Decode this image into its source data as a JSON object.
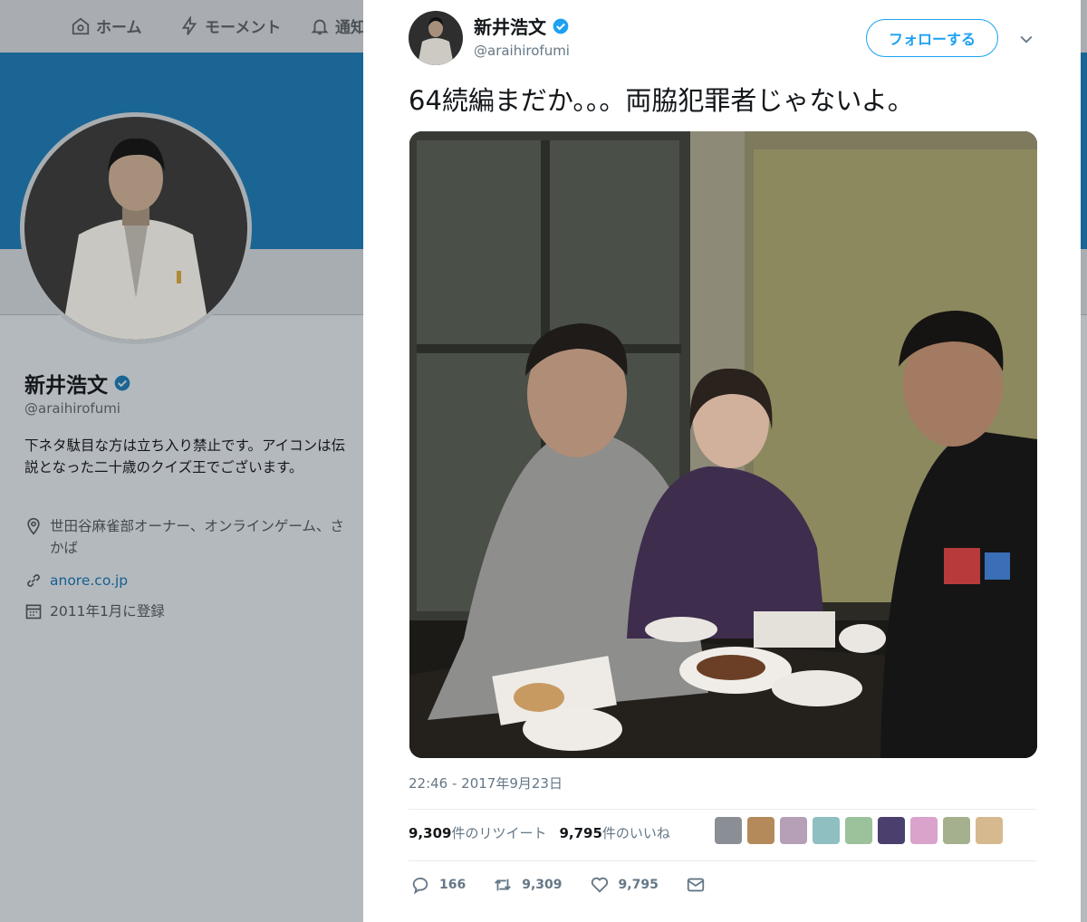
{
  "nav": {
    "home_label": "ホーム",
    "moments_label": "モーメント",
    "notifications_label": "通知"
  },
  "profile": {
    "name": "新井浩文",
    "handle": "@araihirofumi",
    "bio": "下ネタ駄目な方は立ち入り禁止です。アイコンは伝説となった二十歳のクイズ王でございます。",
    "location": "世田谷麻雀部オーナー、オンラインゲーム、さかば",
    "url": "anore.co.jp",
    "joined": "2011年1月に登録"
  },
  "tweet": {
    "author_name": "新井浩文",
    "author_handle": "@araihirofumi",
    "follow_label": "フォローする",
    "text": "64続編まだか。。。両脇犯罪者じゃないよ。",
    "timestamp": "22:46 - 2017年9月23日",
    "retweet_count": "9,309",
    "retweet_suffix": "件のリツイート",
    "like_count": "9,795",
    "like_suffix": "件のいいね",
    "reply_action_count": "166",
    "retweet_action_count": "9,309",
    "like_action_count": "9,795"
  },
  "colors": {
    "accent": "#1da1f2",
    "banner": "#1a6593",
    "overlay_bg": "#b4b9be"
  },
  "icons": [
    "home-icon",
    "lightning-icon",
    "bell-icon",
    "verified-icon",
    "location-icon",
    "link-icon",
    "calendar-icon",
    "chevron-down-icon",
    "reply-icon",
    "retweet-icon",
    "heart-icon",
    "message-icon"
  ]
}
